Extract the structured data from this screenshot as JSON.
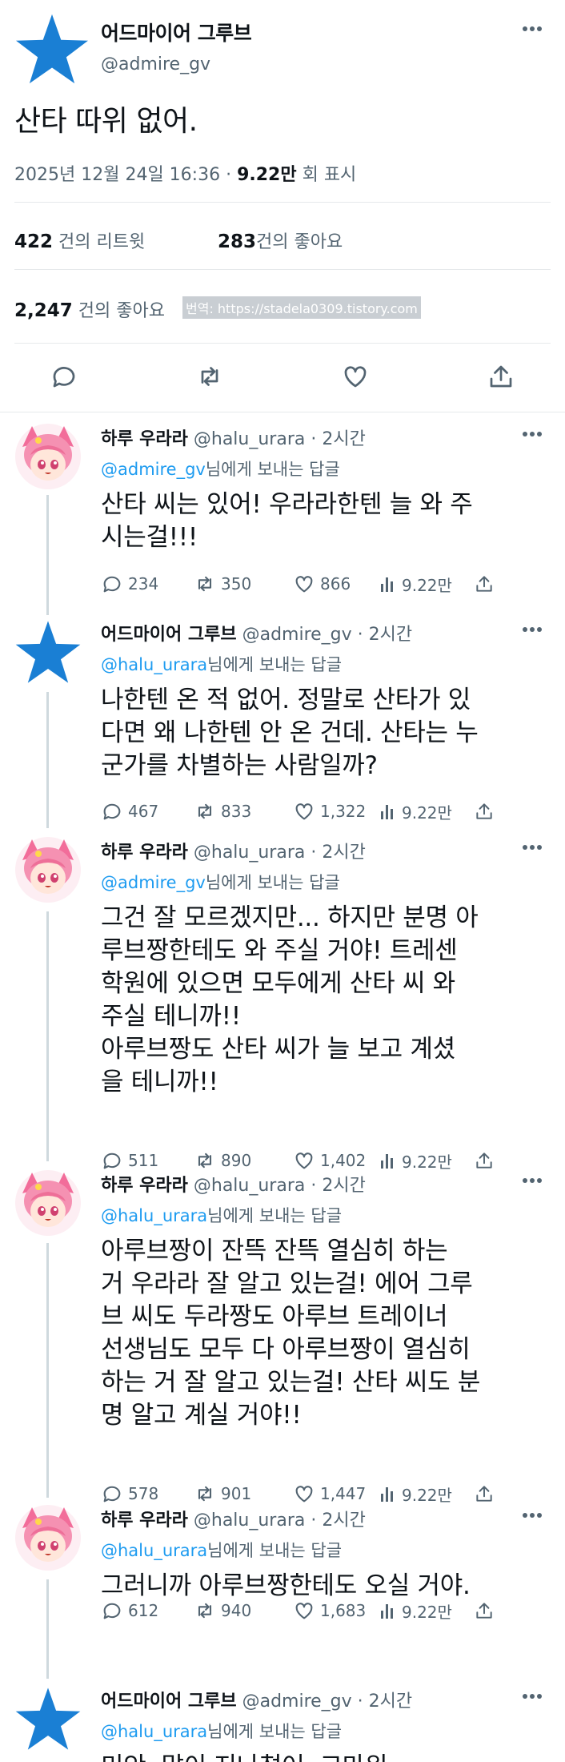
{
  "main_tweet": {
    "display_name": "어드마이어 그루브",
    "handle": "@admire_gv",
    "text": "산타 따위 없어.",
    "date": "2025년 12월 24일  16:36 · ",
    "views": "9.22만",
    "views_suffix": " 회 표시",
    "retweets_count": "422",
    "retweets_label": " 건의 리트윗",
    "quotes_count": "283",
    "quotes_label": "건의 좋아요",
    "likes_count": "2,247",
    "likes_label": " 건의 좋아요",
    "watermark": "번역: https://stadela0309.tistory.com"
  },
  "replies": [
    {
      "display_name": "하루 우라라",
      "handle": "@halu_urara",
      "time": " · 2시간",
      "reply_to": "@admire_gv",
      "reply_suffix": "님에게 보내는 답글",
      "text": "산타 씨는 있어! 우라라한텐 늘 와 주\n시는걸!!!",
      "comments": "234",
      "retweets": "350",
      "likes": "866",
      "views": "9.22만",
      "avatar": "urara"
    },
    {
      "display_name": "어드마이어 그루브",
      "handle": "@admire_gv",
      "time": " · 2시간",
      "reply_to": "@halu_urara",
      "reply_suffix": "님에게 보내는 답글",
      "text": "나한텐 온 적 없어. 정말로 산타가 있\n다면 왜 나한텐 안 온 건데. 산타는 누\n군가를 차별하는 사람일까?",
      "comments": "467",
      "retweets": "833",
      "likes": "1,322",
      "views": "9.22만",
      "avatar": "star"
    },
    {
      "display_name": "하루 우라라",
      "handle": "@halu_urara",
      "time": " · 2시간",
      "reply_to": "@admire_gv",
      "reply_suffix": "님에게 보내는 답글",
      "text": "그건 잘 모르겠지만... 하지만 분명 아\n루브짱한테도 와 주실 거야! 트레센\n학원에 있으면 모두에게 산타 씨 와\n주실 테니까!!\n아루브짱도 산타 씨가 늘 보고 계셨\n을 테니까!!",
      "comments": "511",
      "retweets": "890",
      "likes": "1,402",
      "views": "9.22만",
      "avatar": "urara"
    },
    {
      "display_name": "하루 우라라",
      "handle": "@halu_urara",
      "time": " · 2시간",
      "reply_to": "@halu_urara",
      "reply_suffix": "님에게 보내는 답글",
      "text": "아루브짱이 잔뜩 잔뜩 열심히 하는\n거 우라라 잘 알고 있는걸! 에어 그루\n브 씨도 두라짱도 아루브 트레이너\n선생님도 모두 다 아루브짱이 열심히\n하는 거 잘 알고 있는걸! 산타 씨도 분\n명 알고 계실 거야!!",
      "comments": "578",
      "retweets": "901",
      "likes": "1,447",
      "views": "9.22만",
      "avatar": "urara"
    },
    {
      "display_name": "하루 우라라",
      "handle": "@halu_urara",
      "time": " · 2시간",
      "reply_to": "@halu_urara",
      "reply_suffix": "님에게 보내는 답글",
      "text": "그러니까 아루브짱한테도 오실 거야.",
      "comments": "612",
      "retweets": "940",
      "likes": "1,683",
      "views": "9.22만",
      "avatar": "urara"
    },
    {
      "display_name": "어드마이어 그루브",
      "handle": "@admire_gv",
      "time": " · 2시간",
      "reply_to": "@halu_urara",
      "reply_suffix": "님에게 보내는 답글",
      "text": "미안. 말이 지나쳤어. 고마워.",
      "avatar": "star"
    }
  ],
  "colors": {
    "accent": "#1d9bf0",
    "star": "#1a7fd4",
    "text": "#0f1419",
    "secondary": "#536471"
  },
  "icons": [
    "star-avatar-icon",
    "urara-avatar-icon",
    "more-icon",
    "comment-icon",
    "retweet-icon",
    "like-icon",
    "views-icon",
    "share-icon"
  ]
}
